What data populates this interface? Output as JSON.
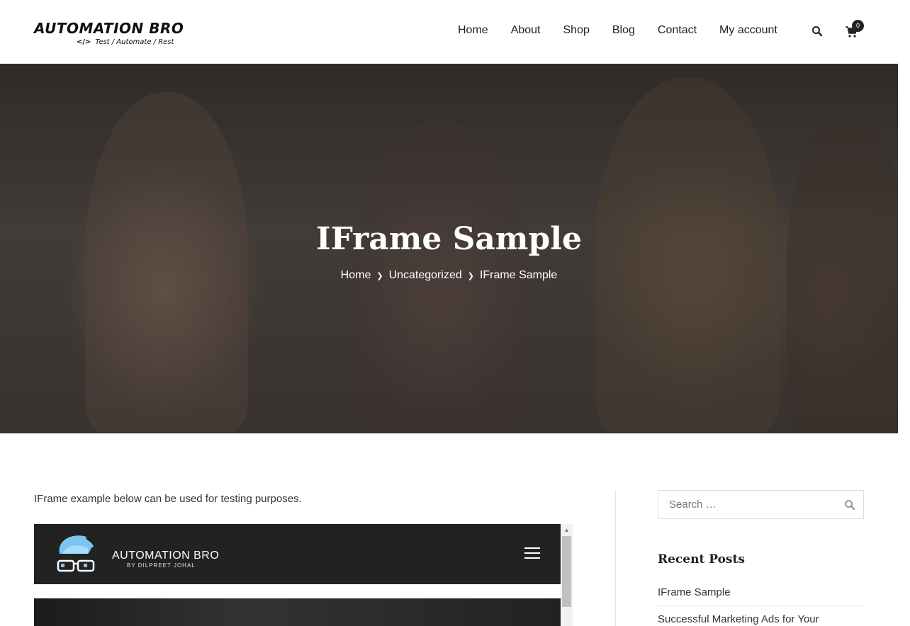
{
  "header": {
    "logo_text": "AUTOMATION BRO",
    "logo_tagline": "Test / Automate / Rest",
    "nav": [
      {
        "label": "Home"
      },
      {
        "label": "About"
      },
      {
        "label": "Shop"
      },
      {
        "label": "Blog"
      },
      {
        "label": "Contact"
      },
      {
        "label": "My account"
      }
    ],
    "cart_count": "0"
  },
  "hero": {
    "title": "IFrame Sample",
    "breadcrumb": [
      "Home",
      "Uncategorized",
      "IFrame Sample"
    ]
  },
  "content": {
    "intro": "IFrame example below can be used for testing purposes.",
    "iframe": {
      "brand": "AUTOMATION BRO",
      "brand_sub": "BY DILPREET JOHAL"
    }
  },
  "sidebar": {
    "search_placeholder": "Search …",
    "recent_title": "Recent Posts",
    "recent_posts": [
      {
        "title": "IFrame Sample"
      },
      {
        "title": "Successful Marketing Ads for Your"
      }
    ]
  }
}
